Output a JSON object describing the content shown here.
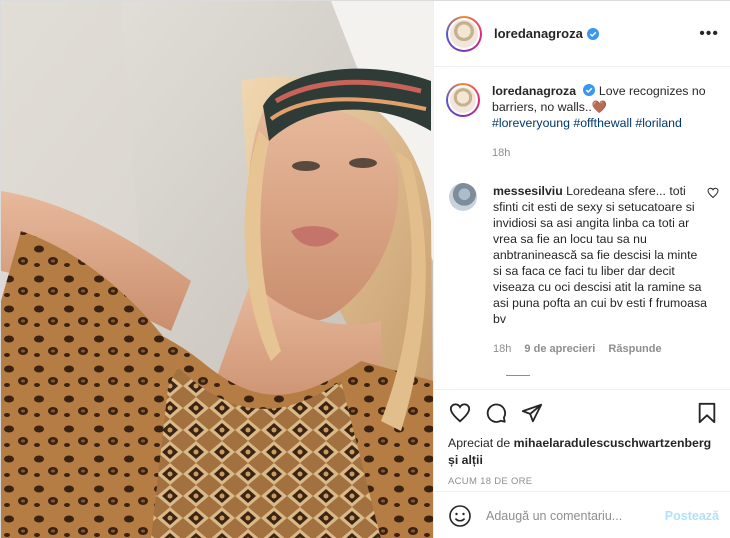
{
  "header": {
    "username": "loredanagroza",
    "verified": true
  },
  "caption": {
    "username": "loredanagroza",
    "text": "Love recognizes no barriers, no walls..",
    "heart_emoji": "🤎",
    "hashtags": [
      "#loreveryoung",
      "#offthewall",
      "#loriland"
    ],
    "time": "18h"
  },
  "comment": {
    "username": "messesilviu",
    "text": "Loredeana sfere... toti sfinti cit esti de sexy si setucatoare si invidiosi sa asi angita linba ca toti ar vrea sa fie an locu tau sa nu anbtraninească sa fie descisi la minte si sa faca ce faci tu liber dar decit viseaza cu oci descisi atit la ramine sa asi puna pofta an cui bv esti f frumoasa bv",
    "time": "18h",
    "likes": "9 de aprecieri",
    "reply_label": "Răspunde"
  },
  "likes": {
    "prefix": "Apreciat de",
    "user": "mihaelaradulescuschwartzenberg",
    "suffix": "și alții"
  },
  "timestamp": "ACUM 18 DE ORE",
  "add_comment": {
    "placeholder": "Adaugă un comentariu...",
    "post_label": "Postează"
  },
  "colors": {
    "link": "#00376b",
    "verified": "#3897f0",
    "post_disabled": "#b2dffc",
    "muted": "#8e8e8e"
  },
  "icons": [
    "heart-icon",
    "comment-icon",
    "share-icon",
    "bookmark-icon",
    "emoji-icon",
    "more-icon",
    "verified-icon"
  ]
}
